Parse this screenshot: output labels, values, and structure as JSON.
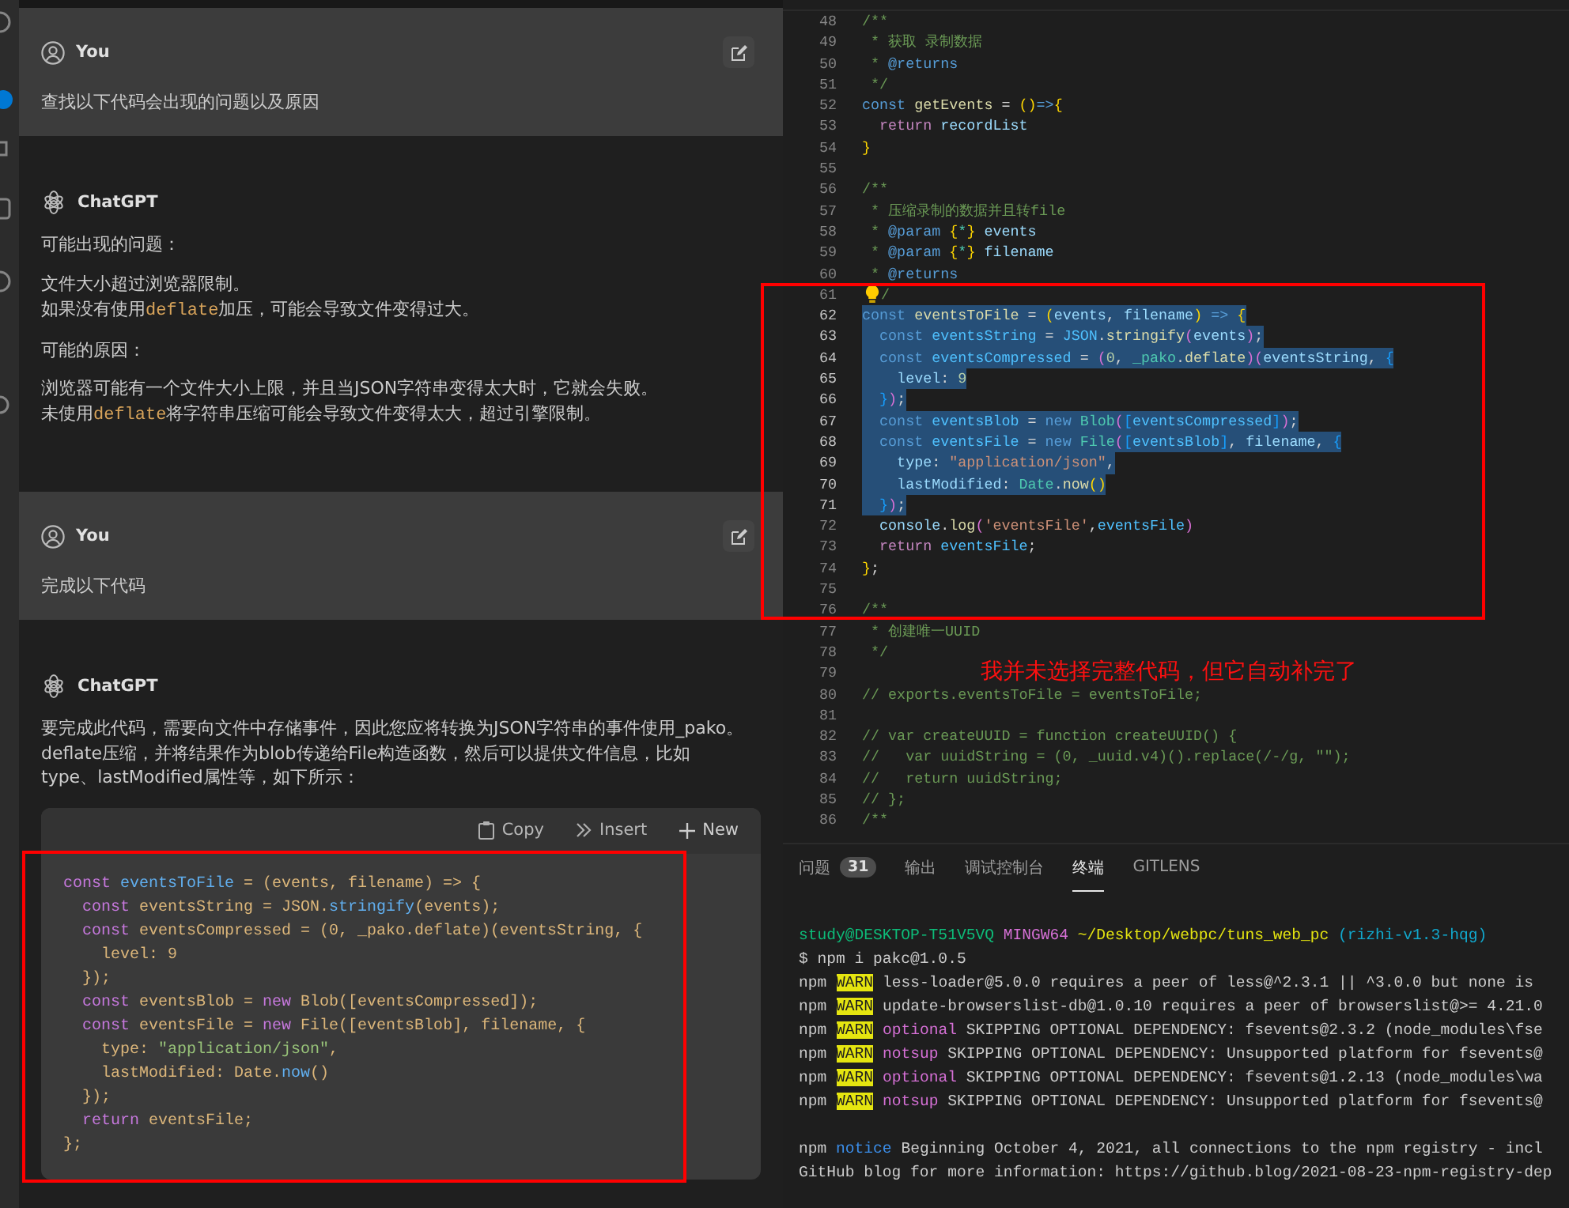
{
  "chat": {
    "messages": [
      {
        "kind": "user",
        "author": "You",
        "blocks": [
          {
            "kind": "paragraph",
            "lines": [
              [
                {
                  "kind": "text",
                  "text": "查找以下代码会出现的问题以及原因"
                }
              ]
            ]
          }
        ]
      },
      {
        "kind": "assistant",
        "author": "ChatGPT",
        "blocks": [
          {
            "kind": "paragraph",
            "lines": [
              [
                {
                  "kind": "text",
                  "text": "可能出现的问题："
                }
              ]
            ]
          },
          {
            "kind": "paragraph",
            "lines": [
              [
                {
                  "kind": "text",
                  "text": "文件大小超过浏览器限制。"
                }
              ],
              [
                {
                  "kind": "text",
                  "text": "如果没有使用"
                },
                {
                  "kind": "code",
                  "text": "deflate"
                },
                {
                  "kind": "text",
                  "text": "加压，可能会导致文件变得过大。"
                }
              ]
            ]
          },
          {
            "kind": "paragraph",
            "lines": [
              [
                {
                  "kind": "text",
                  "text": "可能的原因："
                }
              ]
            ]
          },
          {
            "kind": "paragraph",
            "lines": [
              [
                {
                  "kind": "text",
                  "text": "浏览器可能有一个文件大小上限，并且当JSON字符串变得太大时，它就会失败。"
                }
              ],
              [
                {
                  "kind": "text",
                  "text": "未使用"
                },
                {
                  "kind": "code",
                  "text": "deflate"
                },
                {
                  "kind": "text",
                  "text": "将字符串压缩可能会导致文件变得太大，超过引擎限制。"
                }
              ]
            ]
          }
        ]
      },
      {
        "kind": "user",
        "author": "You",
        "blocks": [
          {
            "kind": "paragraph",
            "lines": [
              [
                {
                  "kind": "text",
                  "text": "完成以下代码"
                }
              ]
            ]
          }
        ]
      },
      {
        "kind": "assistant",
        "author": "ChatGPT",
        "blocks": [
          {
            "kind": "paragraph",
            "lines": [
              [
                {
                  "kind": "text",
                  "text": "要完成此代码，需要向文件中存储事件，因此您应将转换为JSON字符串的事件使用_pako。deflate压缩，并将结果作为blob传递给File构造函数，然后可以提供文件信息，比如type、lastModified属性等，如下所示："
                }
              ]
            ]
          },
          {
            "kind": "code",
            "actions": [
              {
                "label": "Copy"
              },
              {
                "label": "Insert"
              },
              {
                "label": "New"
              }
            ],
            "lines": [
              [
                {
                  "kind": "kw",
                  "text": "const "
                },
                {
                  "kind": "fn",
                  "text": "eventsToFile"
                },
                {
                  "kind": "id",
                  "text": " = (events, filename) => {"
                }
              ],
              [
                {
                  "kind": "kw",
                  "text": "  const"
                },
                {
                  "kind": "id",
                  "text": " eventsString = JSON."
                },
                {
                  "kind": "fn",
                  "text": "stringify"
                },
                {
                  "kind": "id",
                  "text": "(events);"
                }
              ],
              [
                {
                  "kind": "kw",
                  "text": "  const"
                },
                {
                  "kind": "id",
                  "text": " eventsCompressed = (0, _pako.deflate)(eventsString, {"
                }
              ],
              [
                {
                  "kind": "id",
                  "text": "    level: 9"
                }
              ],
              [
                {
                  "kind": "id",
                  "text": "  });"
                }
              ],
              [
                {
                  "kind": "kw",
                  "text": "  const"
                },
                {
                  "kind": "id",
                  "text": " eventsBlob = "
                },
                {
                  "kind": "kw",
                  "text": "new"
                },
                {
                  "kind": "id",
                  "text": " Blob([eventsCompressed]);"
                }
              ],
              [
                {
                  "kind": "kw",
                  "text": "  const"
                },
                {
                  "kind": "id",
                  "text": " eventsFile = "
                },
                {
                  "kind": "kw",
                  "text": "new"
                },
                {
                  "kind": "id",
                  "text": " File([eventsBlob], filename, {"
                }
              ],
              [
                {
                  "kind": "id",
                  "text": "    type: "
                },
                {
                  "kind": "str",
                  "text": "\"application/json\""
                },
                {
                  "kind": "id",
                  "text": ","
                }
              ],
              [
                {
                  "kind": "id",
                  "text": "    lastModified: Date."
                },
                {
                  "kind": "fn",
                  "text": "now"
                },
                {
                  "kind": "id",
                  "text": "()"
                }
              ],
              [
                {
                  "kind": "id",
                  "text": "  });"
                }
              ],
              [
                {
                  "kind": "kw",
                  "text": "  return"
                },
                {
                  "kind": "id",
                  "text": " eventsFile;"
                }
              ],
              [
                {
                  "kind": "id",
                  "text": "};"
                }
              ]
            ]
          }
        ]
      }
    ]
  },
  "editor": {
    "lines": [
      {
        "number": "48",
        "selected": false,
        "lightbulb": false,
        "tokens": [
          {
            "kind": "cm",
            "text": "/**"
          }
        ]
      },
      {
        "number": "49",
        "selected": false,
        "lightbulb": false,
        "tokens": [
          {
            "kind": "cm",
            "text": " * 获取 录制数据"
          }
        ]
      },
      {
        "number": "50",
        "selected": false,
        "lightbulb": false,
        "tokens": [
          {
            "kind": "cm",
            "text": " * "
          },
          {
            "kind": "tag",
            "text": "@returns"
          }
        ]
      },
      {
        "number": "51",
        "selected": false,
        "lightbulb": false,
        "tokens": [
          {
            "kind": "cm",
            "text": " */"
          }
        ]
      },
      {
        "number": "52",
        "selected": false,
        "lightbulb": false,
        "tokens": [
          {
            "kind": "kw",
            "text": "const "
          },
          {
            "kind": "fn",
            "text": "getEvents"
          },
          {
            "kind": "op",
            "text": " = "
          },
          {
            "kind": "b1",
            "text": "()"
          },
          {
            "kind": "kw",
            "text": "=>"
          },
          {
            "kind": "b1",
            "text": "{"
          }
        ]
      },
      {
        "number": "53",
        "selected": false,
        "lightbulb": false,
        "tokens": [
          {
            "kind": "ctl",
            "text": "  return "
          },
          {
            "kind": "var",
            "text": "recordList"
          }
        ]
      },
      {
        "number": "54",
        "selected": false,
        "lightbulb": false,
        "tokens": [
          {
            "kind": "b1",
            "text": "}"
          }
        ]
      },
      {
        "number": "55",
        "selected": false,
        "lightbulb": false
      },
      {
        "number": "56",
        "selected": false,
        "lightbulb": false,
        "tokens": [
          {
            "kind": "cm",
            "text": "/**"
          }
        ]
      },
      {
        "number": "57",
        "selected": false,
        "lightbulb": false,
        "tokens": [
          {
            "kind": "cm",
            "text": " * 压缩录制的数据并且转file"
          }
        ]
      },
      {
        "number": "58",
        "selected": false,
        "lightbulb": false,
        "tokens": [
          {
            "kind": "cm",
            "text": " * "
          },
          {
            "kind": "tag",
            "text": "@param"
          },
          {
            "kind": "b1",
            "text": " {"
          },
          {
            "kind": "cls",
            "text": "*"
          },
          {
            "kind": "b1",
            "text": "}"
          },
          {
            "kind": "var",
            "text": " events"
          }
        ]
      },
      {
        "number": "59",
        "selected": false,
        "lightbulb": false,
        "tokens": [
          {
            "kind": "cm",
            "text": " * "
          },
          {
            "kind": "tag",
            "text": "@param"
          },
          {
            "kind": "b1",
            "text": " {"
          },
          {
            "kind": "cls",
            "text": "*"
          },
          {
            "kind": "b1",
            "text": "}"
          },
          {
            "kind": "var",
            "text": " filename"
          }
        ]
      },
      {
        "number": "60",
        "selected": false,
        "lightbulb": false,
        "tokens": [
          {
            "kind": "cm",
            "text": " * "
          },
          {
            "kind": "tag",
            "text": "@returns"
          }
        ]
      },
      {
        "number": "61",
        "selected": false,
        "lightbulb": true,
        "tokens": [
          {
            "kind": "cm",
            "text": "/"
          }
        ]
      },
      {
        "number": "62",
        "selected": true,
        "lightbulb": false,
        "tokens": [
          {
            "kind": "kw",
            "text": "const "
          },
          {
            "kind": "fn",
            "text": "eventsToFile"
          },
          {
            "kind": "op",
            "text": " = "
          },
          {
            "kind": "b1",
            "text": "("
          },
          {
            "kind": "var",
            "text": "events"
          },
          {
            "kind": "op",
            "text": ", "
          },
          {
            "kind": "var",
            "text": "filename"
          },
          {
            "kind": "b1",
            "text": ")"
          },
          {
            "kind": "kw",
            "text": " => "
          },
          {
            "kind": "b1",
            "text": "{"
          }
        ]
      },
      {
        "number": "63",
        "selected": true,
        "lightbulb": false,
        "tokens": [
          {
            "kind": "kw",
            "text": "  const "
          },
          {
            "kind": "cv",
            "text": "eventsString"
          },
          {
            "kind": "op",
            "text": " = "
          },
          {
            "kind": "cv",
            "text": "JSON"
          },
          {
            "kind": "op",
            "text": "."
          },
          {
            "kind": "fn",
            "text": "stringify"
          },
          {
            "kind": "b2",
            "text": "("
          },
          {
            "kind": "var",
            "text": "events"
          },
          {
            "kind": "b2",
            "text": ")"
          },
          {
            "kind": "op",
            "text": ";"
          }
        ]
      },
      {
        "number": "64",
        "selected": true,
        "lightbulb": false,
        "tokens": [
          {
            "kind": "kw",
            "text": "  const "
          },
          {
            "kind": "cv",
            "text": "eventsCompressed"
          },
          {
            "kind": "op",
            "text": " = "
          },
          {
            "kind": "b2",
            "text": "("
          },
          {
            "kind": "num",
            "text": "0"
          },
          {
            "kind": "op",
            "text": ", "
          },
          {
            "kind": "cls",
            "text": "_pako"
          },
          {
            "kind": "op",
            "text": "."
          },
          {
            "kind": "fn",
            "text": "deflate"
          },
          {
            "kind": "b2",
            "text": ")("
          },
          {
            "kind": "var",
            "text": "eventsString"
          },
          {
            "kind": "op",
            "text": ", "
          },
          {
            "kind": "b3",
            "text": "{"
          }
        ]
      },
      {
        "number": "65",
        "selected": true,
        "lightbulb": false,
        "tokens": [
          {
            "kind": "var",
            "text": "    level"
          },
          {
            "kind": "op",
            "text": ": "
          },
          {
            "kind": "num",
            "text": "9"
          }
        ]
      },
      {
        "number": "66",
        "selected": true,
        "lightbulb": false,
        "tokens": [
          {
            "kind": "b3",
            "text": "  }"
          },
          {
            "kind": "b2",
            "text": ")"
          },
          {
            "kind": "op",
            "text": ";"
          }
        ]
      },
      {
        "number": "67",
        "selected": true,
        "lightbulb": false,
        "tokens": [
          {
            "kind": "kw",
            "text": "  const "
          },
          {
            "kind": "cv",
            "text": "eventsBlob"
          },
          {
            "kind": "op",
            "text": " = "
          },
          {
            "kind": "kw",
            "text": "new "
          },
          {
            "kind": "cls",
            "text": "Blob"
          },
          {
            "kind": "b2",
            "text": "("
          },
          {
            "kind": "b3",
            "text": "["
          },
          {
            "kind": "cv",
            "text": "eventsCompressed"
          },
          {
            "kind": "b3",
            "text": "]"
          },
          {
            "kind": "b2",
            "text": ")"
          },
          {
            "kind": "op",
            "text": ";"
          }
        ]
      },
      {
        "number": "68",
        "selected": true,
        "lightbulb": false,
        "tokens": [
          {
            "kind": "kw",
            "text": "  const "
          },
          {
            "kind": "cv",
            "text": "eventsFile"
          },
          {
            "kind": "op",
            "text": " = "
          },
          {
            "kind": "kw",
            "text": "new "
          },
          {
            "kind": "cls",
            "text": "File"
          },
          {
            "kind": "b2",
            "text": "("
          },
          {
            "kind": "b3",
            "text": "["
          },
          {
            "kind": "cv",
            "text": "eventsBlob"
          },
          {
            "kind": "b3",
            "text": "]"
          },
          {
            "kind": "op",
            "text": ", "
          },
          {
            "kind": "var",
            "text": "filename"
          },
          {
            "kind": "op",
            "text": ", "
          },
          {
            "kind": "b3",
            "text": "{"
          }
        ]
      },
      {
        "number": "69",
        "selected": true,
        "lightbulb": false,
        "tokens": [
          {
            "kind": "var",
            "text": "    type"
          },
          {
            "kind": "op",
            "text": ": "
          },
          {
            "kind": "str",
            "text": "\"application/json\""
          },
          {
            "kind": "op",
            "text": ","
          }
        ]
      },
      {
        "number": "70",
        "selected": true,
        "lightbulb": false,
        "tokens": [
          {
            "kind": "var",
            "text": "    lastModified"
          },
          {
            "kind": "op",
            "text": ": "
          },
          {
            "kind": "cls",
            "text": "Date"
          },
          {
            "kind": "op",
            "text": "."
          },
          {
            "kind": "fn",
            "text": "now"
          },
          {
            "kind": "b1",
            "text": "()"
          }
        ]
      },
      {
        "number": "71",
        "selected": true,
        "lightbulb": false,
        "tokens": [
          {
            "kind": "b3",
            "text": "  }"
          },
          {
            "kind": "b2",
            "text": ")"
          },
          {
            "kind": "op",
            "text": ";"
          }
        ]
      },
      {
        "number": "72",
        "selected": false,
        "lightbulb": false,
        "tokens": [
          {
            "kind": "var",
            "text": "  console"
          },
          {
            "kind": "op",
            "text": "."
          },
          {
            "kind": "fn",
            "text": "log"
          },
          {
            "kind": "b2",
            "text": "("
          },
          {
            "kind": "str",
            "text": "'eventsFile'"
          },
          {
            "kind": "op",
            "text": ","
          },
          {
            "kind": "cv",
            "text": "eventsFile"
          },
          {
            "kind": "b2",
            "text": ")"
          }
        ]
      },
      {
        "number": "73",
        "selected": false,
        "lightbulb": false,
        "tokens": [
          {
            "kind": "ctl",
            "text": "  return "
          },
          {
            "kind": "cv",
            "text": "eventsFile"
          },
          {
            "kind": "op",
            "text": ";"
          }
        ]
      },
      {
        "number": "74",
        "selected": false,
        "lightbulb": false,
        "tokens": [
          {
            "kind": "b1",
            "text": "}"
          },
          {
            "kind": "op",
            "text": ";"
          }
        ]
      },
      {
        "number": "75",
        "selected": false,
        "lightbulb": false
      },
      {
        "number": "76",
        "selected": false,
        "lightbulb": false,
        "tokens": [
          {
            "kind": "cm",
            "text": "/**"
          }
        ]
      },
      {
        "number": "77",
        "selected": false,
        "lightbulb": false,
        "tokens": [
          {
            "kind": "cm",
            "text": " * 创建唯一UUID"
          }
        ]
      },
      {
        "number": "78",
        "selected": false,
        "lightbulb": false,
        "tokens": [
          {
            "kind": "cm",
            "text": " */"
          }
        ]
      },
      {
        "number": "79",
        "selected": false,
        "lightbulb": false
      },
      {
        "number": "80",
        "selected": false,
        "lightbulb": false,
        "tokens": [
          {
            "kind": "cm",
            "text": "// exports.eventsToFile = eventsToFile;"
          }
        ]
      },
      {
        "number": "81",
        "selected": false,
        "lightbulb": false
      },
      {
        "number": "82",
        "selected": false,
        "lightbulb": false,
        "tokens": [
          {
            "kind": "cm",
            "text": "// var createUUID = function createUUID() {"
          }
        ]
      },
      {
        "number": "83",
        "selected": false,
        "lightbulb": false,
        "tokens": [
          {
            "kind": "cm",
            "text": "//   var uuidString = (0, _uuid.v4)().replace(/-/g, \"\");"
          }
        ]
      },
      {
        "number": "84",
        "selected": false,
        "lightbulb": false,
        "tokens": [
          {
            "kind": "cm",
            "text": "//   return uuidString;"
          }
        ]
      },
      {
        "number": "85",
        "selected": false,
        "lightbulb": false,
        "tokens": [
          {
            "kind": "cm",
            "text": "// };"
          }
        ]
      },
      {
        "number": "86",
        "selected": false,
        "lightbulb": false,
        "tokens": [
          {
            "kind": "cm",
            "text": "/**"
          }
        ]
      }
    ]
  },
  "annotation": {
    "text": "我并未选择完整代码，但它自动补完了"
  },
  "panel": {
    "tabs": [
      {
        "label": "问题",
        "badge": "31",
        "selected": false
      },
      {
        "label": "输出",
        "selected": false
      },
      {
        "label": "调试控制台",
        "selected": false
      },
      {
        "label": "终端",
        "selected": true
      },
      {
        "label": "GITLENS",
        "selected": false
      }
    ],
    "terminal": [
      {
        "kind": "output",
        "tokens": [
          {
            "kind": "green",
            "text": "study@DESKTOP-T51V5VQ"
          },
          {
            "kind": "magenta",
            "text": " MINGW64"
          },
          {
            "kind": "yellow",
            "text": " ~/Desktop/webpc/tuns_web_pc"
          },
          {
            "kind": "cyan",
            "text": " (rizhi-v1.3-hqg)"
          }
        ]
      },
      {
        "kind": "output",
        "tokens": [
          {
            "kind": "plain",
            "text": "$ npm i pakc@1.0.5"
          }
        ]
      },
      {
        "kind": "output",
        "tokens": [
          {
            "kind": "plain",
            "text": "npm "
          },
          {
            "kind": "warn",
            "text": "WARN"
          },
          {
            "kind": "plain",
            "text": " less-loader@5.0.0 requires a peer of less@^2.3.1 || ^3.0.0 but none is"
          }
        ]
      },
      {
        "kind": "output",
        "tokens": [
          {
            "kind": "plain",
            "text": "npm "
          },
          {
            "kind": "warn",
            "text": "WARN"
          },
          {
            "kind": "plain",
            "text": " update-browserslist-db@1.0.10 requires a peer of browserslist@>= 4.21.0"
          }
        ]
      },
      {
        "kind": "output",
        "tokens": [
          {
            "kind": "plain",
            "text": "npm "
          },
          {
            "kind": "warn",
            "text": "WARN"
          },
          {
            "kind": "magenta",
            "text": " optional"
          },
          {
            "kind": "plain",
            "text": " SKIPPING OPTIONAL DEPENDENCY: fsevents@2.3.2 (node_modules\\fse"
          }
        ]
      },
      {
        "kind": "output",
        "tokens": [
          {
            "kind": "plain",
            "text": "npm "
          },
          {
            "kind": "warn",
            "text": "WARN"
          },
          {
            "kind": "magenta",
            "text": " notsup"
          },
          {
            "kind": "plain",
            "text": " SKIPPING OPTIONAL DEPENDENCY: Unsupported platform for fsevents@"
          }
        ]
      },
      {
        "kind": "output",
        "tokens": [
          {
            "kind": "plain",
            "text": "npm "
          },
          {
            "kind": "warn",
            "text": "WARN"
          },
          {
            "kind": "magenta",
            "text": " optional"
          },
          {
            "kind": "plain",
            "text": " SKIPPING OPTIONAL DEPENDENCY: fsevents@1.2.13 (node_modules\\wa"
          }
        ]
      },
      {
        "kind": "output",
        "tokens": [
          {
            "kind": "plain",
            "text": "npm "
          },
          {
            "kind": "warn",
            "text": "WARN"
          },
          {
            "kind": "magenta",
            "text": " notsup"
          },
          {
            "kind": "plain",
            "text": " SKIPPING OPTIONAL DEPENDENCY: Unsupported platform for fsevents@"
          }
        ]
      },
      {
        "kind": "blank"
      },
      {
        "kind": "output",
        "tokens": [
          {
            "kind": "plain",
            "text": "npm "
          },
          {
            "kind": "blue",
            "text": "notice"
          },
          {
            "kind": "plain",
            "text": " Beginning October 4, 2021, all connections to the npm registry - incl"
          }
        ]
      },
      {
        "kind": "output",
        "tokens": [
          {
            "kind": "plain",
            "text": "GitHub blog for more information: https://github.blog/2021-08-23-npm-registry-dep"
          }
        ]
      }
    ]
  }
}
